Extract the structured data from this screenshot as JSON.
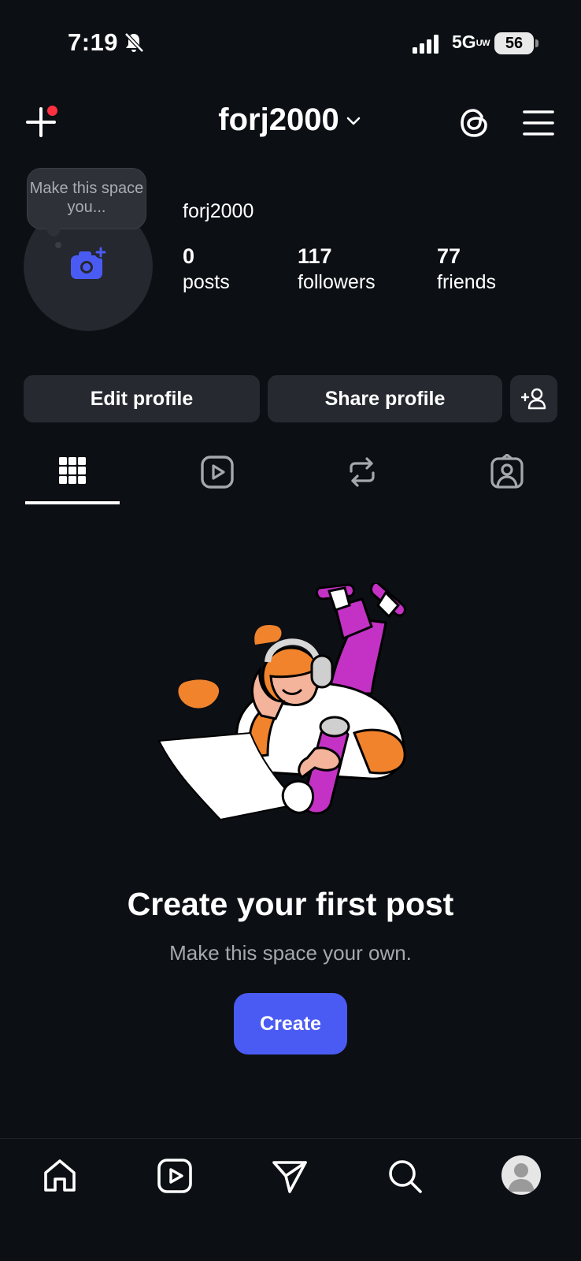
{
  "status_bar": {
    "time": "7:19",
    "network": "5G",
    "network_suffix": "UW",
    "battery": "56"
  },
  "header": {
    "username": "forj2000",
    "icons": [
      "plus-icon",
      "chevron-down-icon",
      "threads-icon",
      "menu-icon"
    ]
  },
  "profile": {
    "name": "forj2000",
    "avatar_tooltip": "Make this space you...",
    "stats": [
      {
        "value": "0",
        "label": "posts"
      },
      {
        "value": "117",
        "label": "followers"
      },
      {
        "value": "77",
        "label": "friends"
      }
    ]
  },
  "actions": {
    "edit_label": "Edit profile",
    "share_label": "Share profile"
  },
  "tabs": [
    "grid-icon",
    "reels-icon",
    "reposts-icon",
    "tagged-icon"
  ],
  "empty_state": {
    "title": "Create your first post",
    "subtitle": "Make this space your own.",
    "button_label": "Create"
  },
  "bottom_nav": [
    "home-icon",
    "reels-icon",
    "send-icon",
    "search-icon",
    "profile-avatar"
  ],
  "colors": {
    "background": "#0c0f14",
    "button": "#262a30",
    "accent": "#4a5bf3",
    "notification": "#ff3040"
  }
}
